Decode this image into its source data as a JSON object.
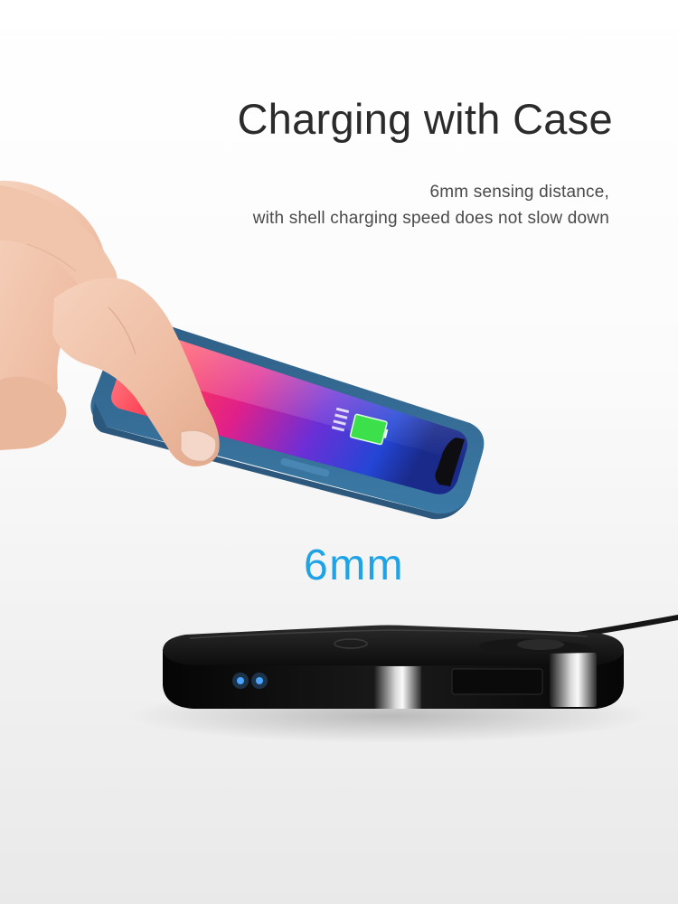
{
  "headline": "Charging with Case",
  "subtitle": {
    "line1": "6mm sensing distance,",
    "line2": "with shell charging speed does not slow down"
  },
  "distance_label": "6mm",
  "colors": {
    "accent": "#1fa3e6",
    "heading": "#2b2b2b",
    "case_blue": "#35688f",
    "led_blue": "#4aa3ff",
    "charger_black": "#111111"
  },
  "icons": {
    "battery": "battery-charging-icon"
  }
}
